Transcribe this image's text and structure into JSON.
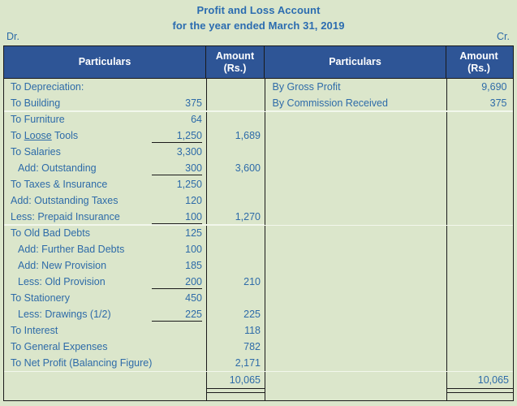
{
  "document": {
    "title_line_1": "Profit and Loss Account",
    "title_line_2": "for the year ended March 31, 2019",
    "debit_marker": "Dr.",
    "credit_marker": "Cr."
  },
  "colors": {
    "page_background": "#dbe6cb",
    "header_background": "#2e5596",
    "header_text": "#ffffff",
    "body_text": "#2e6ba8",
    "border": "#1a1a1a"
  },
  "table": {
    "headers": {
      "particulars_left_line1": "Particulars",
      "amount_left_line1": "Amount",
      "amount_left_line2": "(Rs.)",
      "particulars_right_line1": "Particulars",
      "amount_right_line1": "Amount",
      "amount_right_line2": "(Rs.)"
    },
    "debit_rows": [
      {
        "label": "To Depreciation:",
        "indent": false,
        "inner": "",
        "outer": "",
        "rule": false,
        "spell_word": ""
      },
      {
        "label": "To Building",
        "indent": false,
        "inner": "375",
        "outer": "",
        "rule": false,
        "spell_word": ""
      },
      {
        "label": "To Furniture",
        "indent": false,
        "inner": "64",
        "outer": "",
        "rule": false,
        "spell_word": ""
      },
      {
        "label": "To Loose Tools",
        "indent": false,
        "inner": "1,250",
        "outer": "1,689",
        "rule": true,
        "spell_word": "Loose"
      },
      {
        "label": "To Salaries",
        "indent": false,
        "inner": "3,300",
        "outer": "",
        "rule": false,
        "spell_word": ""
      },
      {
        "label": "Add: Outstanding",
        "indent": true,
        "inner": "300",
        "outer": "3,600",
        "rule": true,
        "spell_word": ""
      },
      {
        "label": "To Taxes & Insurance",
        "indent": false,
        "inner": "1,250",
        "outer": "",
        "rule": false,
        "spell_word": ""
      },
      {
        "label": "Add: Outstanding Taxes",
        "indent": false,
        "inner": "120",
        "outer": "",
        "rule": false,
        "spell_word": ""
      },
      {
        "label": "Less: Prepaid Insurance",
        "indent": false,
        "inner": "100",
        "outer": "1,270",
        "rule": true,
        "spell_word": ""
      },
      {
        "label": "To Old Bad Debts",
        "indent": false,
        "inner": "125",
        "outer": "",
        "rule": false,
        "spell_word": ""
      },
      {
        "label": "Add: Further Bad Debts",
        "indent": true,
        "inner": "100",
        "outer": "",
        "rule": false,
        "spell_word": ""
      },
      {
        "label": "Add: New Provision",
        "indent": true,
        "inner": "185",
        "outer": "",
        "rule": false,
        "spell_word": ""
      },
      {
        "label": "Less: Old Provision",
        "indent": true,
        "inner": "200",
        "outer": "210",
        "rule": true,
        "spell_word": ""
      },
      {
        "label": "To Stationery",
        "indent": false,
        "inner": "450",
        "outer": "",
        "rule": false,
        "spell_word": ""
      },
      {
        "label": "Less: Drawings (1/2)",
        "indent": true,
        "inner": "225",
        "outer": "225",
        "rule": true,
        "spell_word": ""
      },
      {
        "label": "To Interest",
        "indent": false,
        "inner": "",
        "outer": "118",
        "rule": false,
        "spell_word": ""
      },
      {
        "label": "To General Expenses",
        "indent": false,
        "inner": "",
        "outer": "782",
        "rule": false,
        "spell_word": ""
      },
      {
        "label": "To Net Profit (Balancing Figure)",
        "indent": false,
        "inner": "",
        "outer": "2,171",
        "rule": false,
        "spell_word": ""
      }
    ],
    "credit_rows": [
      {
        "label": "By Gross Profit",
        "amount": "9,690"
      },
      {
        "label": "By Commission Received",
        "amount": "375"
      }
    ],
    "totals": {
      "debit_total": "10,065",
      "credit_total": "10,065"
    }
  }
}
